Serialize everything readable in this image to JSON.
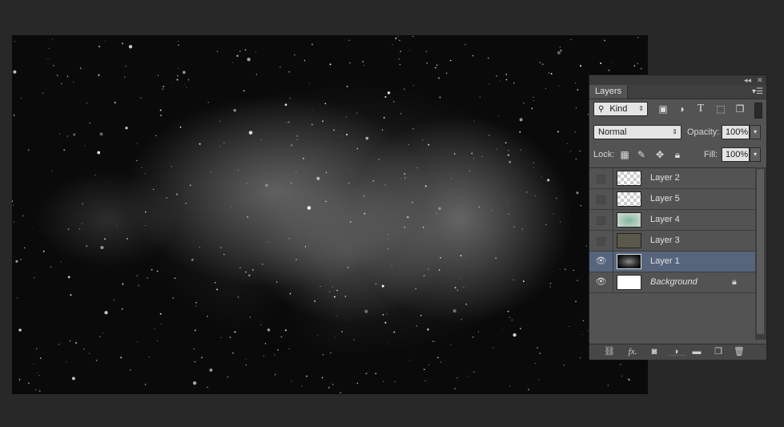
{
  "panel": {
    "collapse_icon": "double-chevron-left-icon",
    "close_icon": "close-icon",
    "tab_label": "Layers",
    "menu_icon": "panel-menu-icon"
  },
  "filter": {
    "kind_label": "Kind",
    "icons": [
      "image-filter-icon",
      "adjustment-filter-icon",
      "type-filter-icon",
      "shape-filter-icon",
      "smart-object-filter-icon"
    ]
  },
  "blend": {
    "mode": "Normal",
    "opacity_label": "Opacity:",
    "opacity_value": "100%"
  },
  "lock": {
    "label": "Lock:",
    "fill_label": "Fill:",
    "fill_value": "100%"
  },
  "layers": [
    {
      "name": "Layer 2",
      "visible": false,
      "thumb": "transparent",
      "selected": false,
      "locked": false
    },
    {
      "name": "Layer 5",
      "visible": false,
      "thumb": "transparent",
      "selected": false,
      "locked": false
    },
    {
      "name": "Layer 4",
      "visible": false,
      "thumb": "green-cloud",
      "selected": false,
      "locked": false
    },
    {
      "name": "Layer 3",
      "visible": false,
      "thumb": "olive-fill",
      "selected": false,
      "locked": false
    },
    {
      "name": "Layer 1",
      "visible": true,
      "thumb": "nebula",
      "selected": true,
      "locked": false
    },
    {
      "name": "Background",
      "visible": true,
      "thumb": "white",
      "selected": false,
      "locked": true
    }
  ],
  "bottom_icons": [
    "link-layers-icon",
    "fx-icon",
    "add-mask-icon",
    "new-adjustment-icon",
    "new-group-icon",
    "new-layer-icon",
    "delete-layer-icon"
  ],
  "colors": {
    "selected_row": "#56657c",
    "panel_bg": "#535353",
    "app_bg": "#282828"
  }
}
